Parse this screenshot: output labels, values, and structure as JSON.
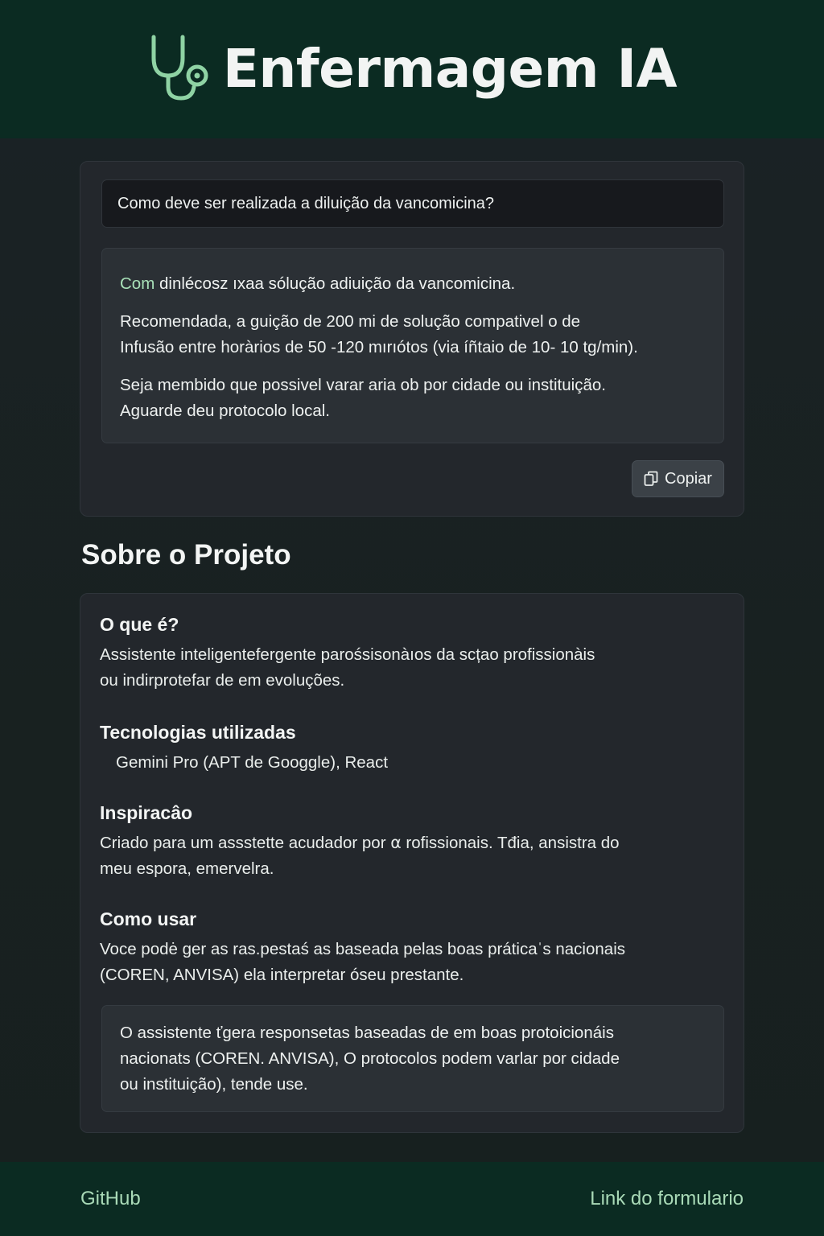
{
  "header": {
    "title": "Enfermagem IA",
    "icon": "stethoscope-icon",
    "brand_color": "#0b2b22",
    "accent_color": "#8fd3a4"
  },
  "chat": {
    "question": "Como deve ser realizada a diluição da vancomicina?",
    "answer": {
      "p1_accent": "Com",
      "p1_rest": " dinlécosz ıxaa sólução adiuição da vancomicina.",
      "p2_line1": "Recomendada, a guição de 200 mi de solução compativel o de",
      "p2_line2": "Infusão entre horàrios de 50 -120 mırıótos (via íñtaio de 10- 10 tg/min).",
      "p3_line1": "Seja membido que possivel varar aria ob por cidade ou instituição.",
      "p3_line2": "Aguarde deu protocolo local."
    },
    "copy_label": "Copiar",
    "copy_icon": "copy-icon"
  },
  "about": {
    "title": "Sobre o Projeto",
    "what": {
      "heading": "O que é?",
      "line1": "Assistente inteligentefergente parośsisonàıos da scțao profissionàis",
      "line2": "ou indirprotefar de em evoluções."
    },
    "tech": {
      "heading": "Tecnologias utilizadas",
      "text": "Gemini Pro (APT de Googgle), React"
    },
    "inspiration": {
      "heading": "Inspiracâo",
      "line1": "Criado para um assstette acudador por ⍺ rofissionais. Tđia, ansistra do",
      "line2": "meu espora, emervelra."
    },
    "usage": {
      "heading": "Como usar",
      "line1": "Voce podė ger as ras.pestaś as baseada pelas boas práticaˈs nacionais",
      "line2": "(COREN, ANVISA) ela interpretar óseu prestante."
    },
    "note": {
      "line1": "O assistente ťgera responsetas baseadas de em boas protoicionáis",
      "line2": "nacionats (COREN. ANVISA), O protocolos podem varlar por cidade",
      "line3": "ou instituição), tende use."
    }
  },
  "footer": {
    "github": "GitHub",
    "form_link": "Link do formulario"
  }
}
